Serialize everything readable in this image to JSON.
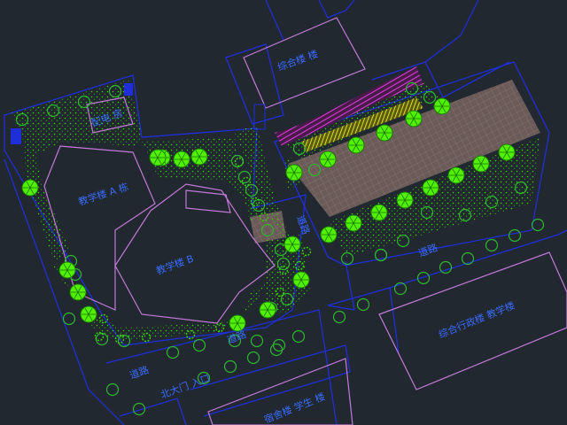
{
  "labels": {
    "north_building": "综合楼 楼",
    "main_building_1": "教学楼 A 栋",
    "main_building_2": "教学楼 B",
    "east_building": "综合行政楼 教学楼",
    "south_building": "宿舍楼 学生 楼",
    "small_building": "配电 房",
    "road_1": "道路",
    "road_2": "道路",
    "road_3": "道路",
    "road_4": "道路",
    "gate": "北大门 入口"
  },
  "colors": {
    "background": "#212830",
    "site_line": "#1f2fd8",
    "building_line": "#c47ad8",
    "shrub_green": "#3ad400",
    "tree_fill": "#52f000",
    "paving": "#6a5a58",
    "paving_grid": "#8a7672",
    "flower_magenta": "#e040e0",
    "flower_yellow": "#e8f020",
    "label_blue": "#3a6cff"
  }
}
